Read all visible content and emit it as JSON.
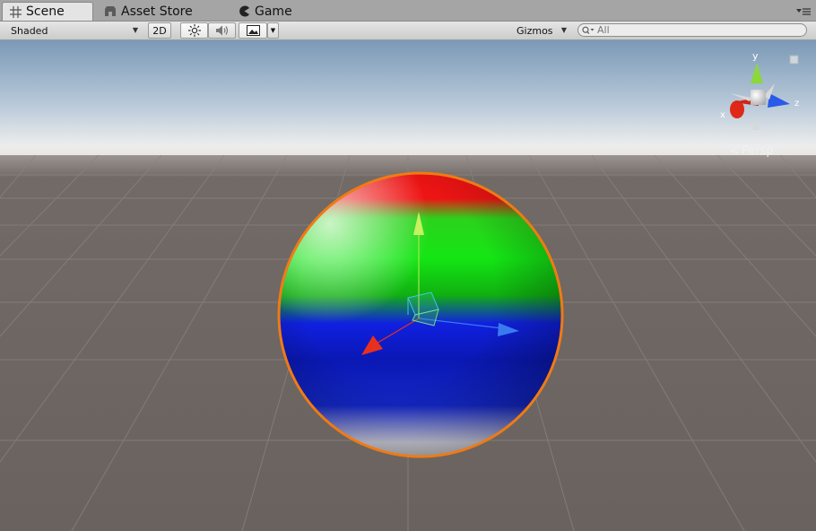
{
  "tabs": [
    {
      "label": "Scene",
      "icon": "grid-icon",
      "active": true
    },
    {
      "label": "Asset Store",
      "icon": "store-icon",
      "active": false
    },
    {
      "label": "Game",
      "icon": "pacman-icon",
      "active": false
    }
  ],
  "toolbar": {
    "draw_mode": "Shaded",
    "mode_2d": "2D",
    "lighting_icon": "sun-icon",
    "audio_icon": "speaker-icon",
    "effects_icon": "image-icon",
    "gizmos_label": "Gizmos",
    "search_placeholder": "All"
  },
  "scene": {
    "projection_label": "Persp",
    "axis_labels": {
      "x": "x",
      "y": "y",
      "z": "z"
    },
    "colors": {
      "sky_top": "#7b99b7",
      "horizon": "#f0f0f0",
      "ground": "#6b635f",
      "selection_outline": "#f07a14",
      "axis_x": "#e8301e",
      "axis_y": "#a8e84a",
      "axis_z": "#3a7af0"
    },
    "object_bands": [
      "red",
      "green",
      "blue",
      "white"
    ]
  }
}
